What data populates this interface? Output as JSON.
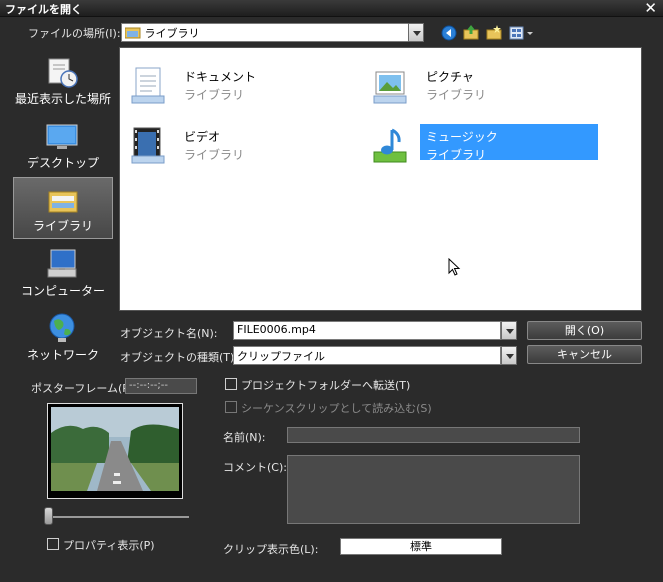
{
  "window": {
    "title": "ファイルを開く",
    "close_glyph": "✕"
  },
  "location": {
    "label": "ファイルの場所(I):",
    "value": "ライブラリ",
    "toolbar_icons": [
      "back-icon",
      "up-folder-icon",
      "new-folder-icon",
      "view-menu-icon"
    ]
  },
  "places": [
    {
      "label": "最近表示した場所",
      "icon": "recent-places-icon",
      "selected": false
    },
    {
      "label": "デスクトップ",
      "icon": "desktop-icon",
      "selected": false
    },
    {
      "label": "ライブラリ",
      "icon": "libraries-icon",
      "selected": true
    },
    {
      "label": "コンピューター",
      "icon": "computer-icon",
      "selected": false
    },
    {
      "label": "ネットワーク",
      "icon": "network-icon",
      "selected": false
    }
  ],
  "files": [
    {
      "name": "ドキュメント",
      "type": "ライブラリ",
      "icon": "documents-library-icon",
      "selected": false
    },
    {
      "name": "ピクチャ",
      "type": "ライブラリ",
      "icon": "pictures-library-icon",
      "selected": false
    },
    {
      "name": "ビデオ",
      "type": "ライブラリ",
      "icon": "videos-library-icon",
      "selected": false
    },
    {
      "name": "ミュージック",
      "type": "ライブラリ",
      "icon": "music-library-icon",
      "selected": true
    }
  ],
  "object_name": {
    "label": "オブジェクト名(N):",
    "value": "FILE0006.mp4"
  },
  "object_type": {
    "label": "オブジェクトの種類(T):",
    "value": "クリップファイル"
  },
  "buttons": {
    "open": "開く(O)",
    "cancel": "キャンセル"
  },
  "poster_frame": {
    "label": "ポスターフレーム(R):",
    "timecode": "--:--:--;--"
  },
  "options": {
    "transfer_project_folder": {
      "label": "プロジェクトフォルダーへ転送(T)",
      "checked": false,
      "enabled": true
    },
    "load_as_sequence": {
      "label": "シーケンスクリップとして読み込む(S)",
      "checked": false,
      "enabled": false
    }
  },
  "name_field": {
    "label": "名前(N):",
    "value": ""
  },
  "comment_field": {
    "label": "コメント(C):",
    "value": ""
  },
  "properties": {
    "label": "プロパティ表示(P)",
    "checked": false
  },
  "clip_color": {
    "label": "クリップ表示色(L):",
    "value": "標準"
  },
  "colors": {
    "accent": "#3399ff",
    "panel": "#2b2b2b",
    "selected_place": "#555555"
  }
}
